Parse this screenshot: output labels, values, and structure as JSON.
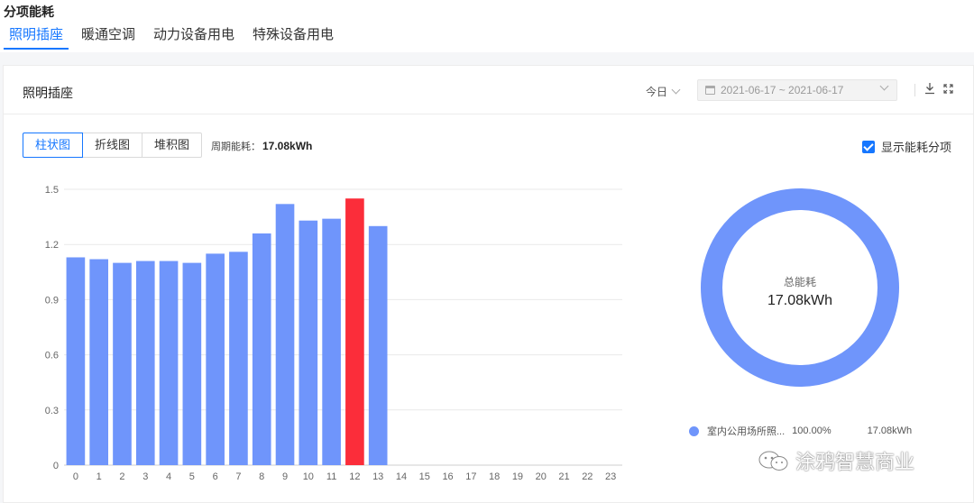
{
  "page": {
    "title": "分项能耗",
    "tabs": [
      {
        "label": "照明插座",
        "active": true
      },
      {
        "label": "暖通空调",
        "active": false
      },
      {
        "label": "动力设备用电",
        "active": false
      },
      {
        "label": "特殊设备用电",
        "active": false
      }
    ]
  },
  "card": {
    "title": "照明插座",
    "period_label": "今日",
    "date_range": "2021-06-17 ~ 2021-06-17",
    "chart_types": [
      {
        "label": "柱状图",
        "active": true
      },
      {
        "label": "折线图",
        "active": false
      },
      {
        "label": "堆积图",
        "active": false
      }
    ],
    "period_energy_label": "周期能耗：",
    "period_energy_value": "17.08kWh",
    "show_breakdown_label": "显示能耗分项",
    "show_breakdown_checked": true
  },
  "donut": {
    "label": "总能耗",
    "value": "17.08kWh",
    "legend": [
      {
        "name": "室内公用场所照...",
        "percent": "100.00%",
        "value": "17.08kWh"
      }
    ]
  },
  "watermark": "涂鸦智慧商业",
  "colors": {
    "accent": "#1677ff",
    "bar": "#6f95fb",
    "bar_highlight": "#fb2d3a"
  },
  "chart_data": [
    {
      "type": "bar",
      "categories": [
        "0",
        "1",
        "2",
        "3",
        "4",
        "5",
        "6",
        "7",
        "8",
        "9",
        "10",
        "11",
        "12",
        "13",
        "14",
        "15",
        "16",
        "17",
        "18",
        "19",
        "20",
        "21",
        "22",
        "23"
      ],
      "values": [
        1.13,
        1.12,
        1.1,
        1.11,
        1.11,
        1.1,
        1.15,
        1.16,
        1.26,
        1.42,
        1.33,
        1.34,
        1.45,
        1.3,
        null,
        null,
        null,
        null,
        null,
        null,
        null,
        null,
        null,
        null
      ],
      "highlight_index": 12,
      "yticks": [
        "0",
        "0.3",
        "0.6",
        "0.9",
        "1.2",
        "1.5"
      ],
      "ylim": [
        0,
        1.5
      ],
      "grid": true
    },
    {
      "type": "pie",
      "labels": [
        "室内公用场所照..."
      ],
      "values": [
        100
      ],
      "donut": true
    }
  ]
}
